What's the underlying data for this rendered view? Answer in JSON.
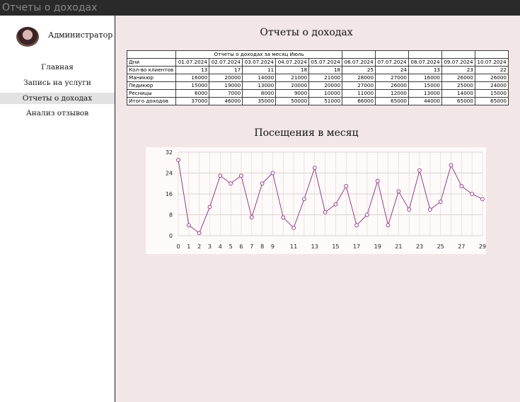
{
  "window": {
    "title": "Отчеты о доходах"
  },
  "sidebar": {
    "user_name": "Администратор",
    "items": [
      {
        "label": "Главная"
      },
      {
        "label": "Запись на услуги"
      },
      {
        "label": "Отчеты о доходах"
      },
      {
        "label": "Анализ отзывов"
      }
    ]
  },
  "main": {
    "title": "Отчеты о доходах",
    "table": {
      "caption": "Отчеты о доходах за месяц Июль",
      "header_label": "Дни",
      "dates": [
        "01.07.2024",
        "02.07.2024",
        "03.07.2024",
        "04.07.2024",
        "05.07.2024",
        "06.07.2024",
        "07.07.2024",
        "08.07.2024",
        "09.07.2024",
        "10.07.2024"
      ],
      "rows": [
        {
          "label": "Кол-во клиентов",
          "values": [
            "13",
            "17",
            "11",
            "18",
            "18",
            "25",
            "24",
            "13",
            "23",
            "22"
          ]
        },
        {
          "label": "Маникюр",
          "values": [
            "16000",
            "20000",
            "14000",
            "21000",
            "21000",
            "28000",
            "27000",
            "16000",
            "26000",
            "26000"
          ]
        },
        {
          "label": "Педикюр",
          "values": [
            "15000",
            "19000",
            "13000",
            "20000",
            "20000",
            "27000",
            "26000",
            "15000",
            "25000",
            "24000"
          ]
        },
        {
          "label": "Ресницы",
          "values": [
            "6000",
            "7000",
            "8000",
            "9000",
            "10000",
            "11000",
            "12000",
            "13000",
            "14000",
            "15000"
          ]
        },
        {
          "label": "Итого доходов",
          "values": [
            "37000",
            "46000",
            "35000",
            "50000",
            "51000",
            "66000",
            "65000",
            "44000",
            "65000",
            "65000"
          ]
        }
      ]
    },
    "chart_title": "Посещения в месяц"
  },
  "chart_data": {
    "type": "line",
    "title": "Посещения в месяц",
    "x": [
      0,
      1,
      2,
      3,
      4,
      5,
      6,
      7,
      8,
      9,
      10,
      11,
      12,
      13,
      14,
      15,
      16,
      17,
      18,
      19,
      20,
      21,
      22,
      23,
      24,
      25,
      26,
      27,
      28,
      29
    ],
    "series": [
      {
        "values": [
          29,
          4,
          1,
          11,
          23,
          20,
          23,
          7,
          20,
          24,
          7,
          3,
          14,
          26,
          9,
          12,
          19,
          4,
          8,
          21,
          4,
          17,
          10,
          25,
          10,
          13,
          27,
          19,
          16,
          14
        ]
      }
    ],
    "x_ticks": [
      0,
      1,
      2,
      3,
      4,
      5,
      6,
      7,
      8,
      9,
      11,
      13,
      15,
      17,
      19,
      21,
      23,
      25,
      27,
      29
    ],
    "y_ticks": [
      0,
      8,
      16,
      24,
      32
    ],
    "ylim": [
      0,
      32
    ],
    "xlim": [
      0,
      29
    ],
    "grid": true,
    "line_color": "#8b2a7a"
  }
}
